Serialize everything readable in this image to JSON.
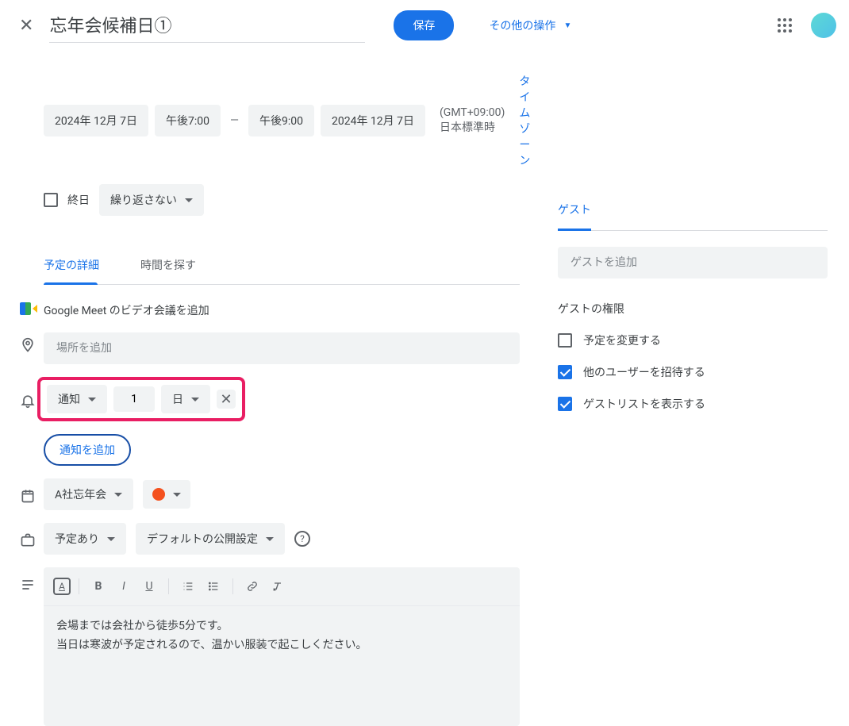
{
  "header": {
    "title": "忘年会候補日①",
    "save_label": "保存",
    "more_actions_label": "その他の操作"
  },
  "datetime": {
    "start_date": "2024年 12月 7日",
    "start_time": "午後7:00",
    "separator": "—",
    "end_time": "午後9:00",
    "end_date": "2024年 12月 7日",
    "timezone_info": "(GMT+09:00) 日本標準時",
    "timezone_link": "タイムゾーン"
  },
  "allday": {
    "label": "終日",
    "recurrence": "繰り返さない"
  },
  "tabs": {
    "details": "予定の詳細",
    "find_time": "時間を探す"
  },
  "meet": {
    "add_label": "Google Meet のビデオ会議を追加"
  },
  "location": {
    "placeholder": "場所を追加"
  },
  "notification": {
    "method": "通知",
    "value": "1",
    "unit": "日",
    "add_label": "通知を追加"
  },
  "calendar": {
    "name": "A社忘年会",
    "color": "#f4511e"
  },
  "availability": {
    "busy": "予定あり",
    "visibility": "デフォルトの公開設定"
  },
  "description": {
    "line1": "会場までは会社から徒歩5分です。",
    "line2": "当日は寒波が予定されるので、温かい服装で起こしください。"
  },
  "guests": {
    "header": "ゲスト",
    "input_placeholder": "ゲストを追加",
    "permissions_title": "ゲストの権限",
    "perm_modify": "予定を変更する",
    "perm_invite": "他のユーザーを招待する",
    "perm_see": "ゲストリストを表示する"
  }
}
